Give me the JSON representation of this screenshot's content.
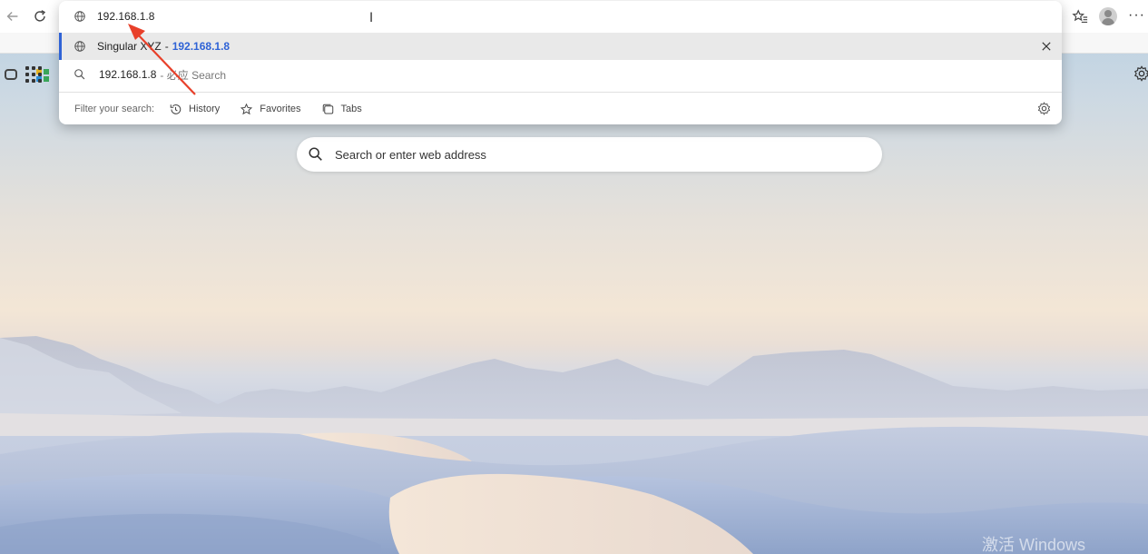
{
  "omnibox": {
    "input_value": "192.168.1.8",
    "suggestions": [
      {
        "title": "Singular XYZ",
        "separator": "-",
        "url": "192.168.1.8"
      },
      {
        "query": "192.168.1.8",
        "engine_suffix": "- 必应 Search"
      }
    ],
    "filter_label": "Filter your search:",
    "filters": [
      {
        "label": "History",
        "icon": "history-icon"
      },
      {
        "label": "Favorites",
        "icon": "star-icon"
      },
      {
        "label": "Tabs",
        "icon": "tabs-icon"
      }
    ]
  },
  "new_tab": {
    "search_placeholder": "Search or enter web address"
  },
  "watermark": "激活 Windows",
  "colors": {
    "accent_blue": "#2f63d6",
    "annotation_red": "#e8402a"
  }
}
